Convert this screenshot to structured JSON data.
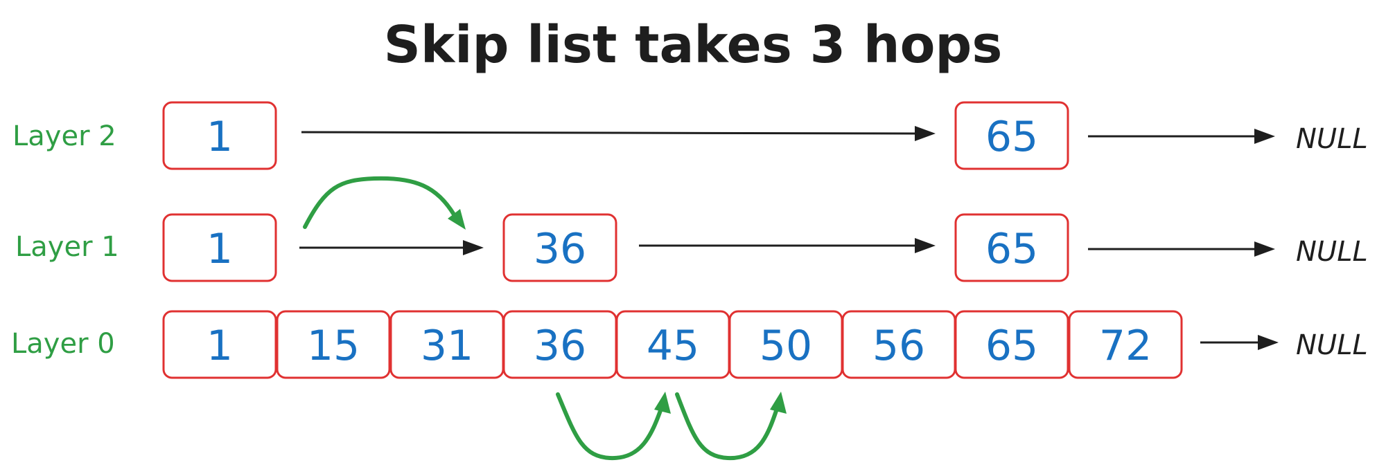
{
  "title": "Skip list takes 3 hops",
  "null_label": "NULL",
  "layers": [
    {
      "label": "Layer 2",
      "nodes": [
        "1",
        "65"
      ]
    },
    {
      "label": "Layer 1",
      "nodes": [
        "1",
        "36",
        "65"
      ]
    },
    {
      "label": "Layer 0",
      "nodes": [
        "1",
        "15",
        "31",
        "36",
        "45",
        "50",
        "56",
        "65",
        "72"
      ]
    }
  ],
  "hops": [
    {
      "layer": "Layer 1",
      "from": "1",
      "to": "36"
    },
    {
      "layer": "Layer 0",
      "from": "36",
      "to": "45"
    },
    {
      "layer": "Layer 0",
      "from": "45",
      "to": "50"
    }
  ],
  "colors": {
    "node_border": "#e03131",
    "node_value": "#1971c2",
    "layer_label": "#2f9e44",
    "hop_arrow": "#2f9e44",
    "pointer": "#1e1e1e"
  }
}
